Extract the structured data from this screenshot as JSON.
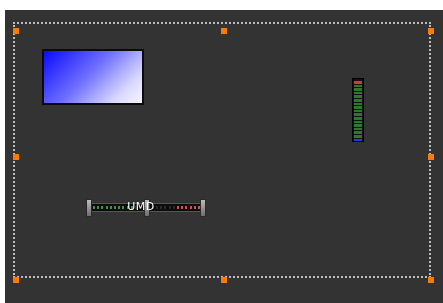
{
  "canvas": {
    "background": "#333333",
    "selection": {
      "border_color": "#bdbdbd",
      "handle_color": "#ff7a00"
    }
  },
  "gradient_panel": {
    "colors": [
      "#0a0aff",
      "#6e6eff",
      "#d8d8ff",
      "#f5f5ff"
    ]
  },
  "vertical_meter": {
    "segment_colors": [
      "#d43b3b",
      "#2b7a2b",
      "#2b7a2b",
      "#2b7a2b",
      "#2b7a2b",
      "#2b7a2b",
      "#2b7a2b",
      "#2b7a2b",
      "#2b7a2b",
      "#2b7a2b",
      "#2b7a2b",
      "#2b7a2b",
      "#2b7a2b",
      "#2b7a2b",
      "#2b7a2b",
      "#2b7a2b",
      "#3030ff"
    ]
  },
  "horizontal_meter": {
    "label": "UMD",
    "tick_colors": {
      "left": "#3a9a3a",
      "right": "#d45050"
    }
  }
}
